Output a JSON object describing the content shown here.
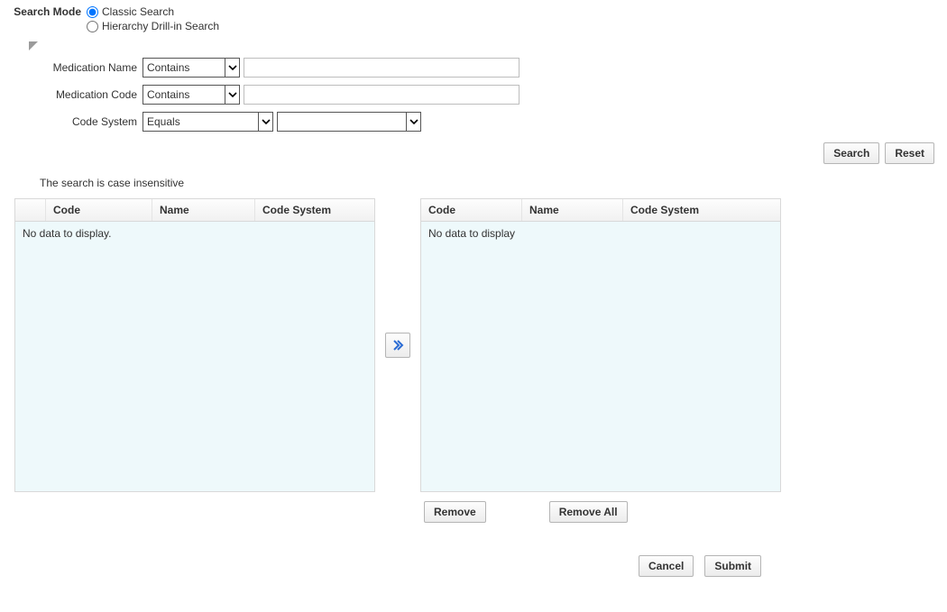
{
  "searchMode": {
    "label": "Search Mode",
    "options": {
      "classic": "Classic Search",
      "hierarchy": "Hierarchy Drill-in Search"
    },
    "selected": "classic"
  },
  "fields": {
    "medicationName": {
      "label": "Medication Name",
      "operator": "Contains",
      "value": ""
    },
    "medicationCode": {
      "label": "Medication Code",
      "operator": "Contains",
      "value": ""
    },
    "codeSystem": {
      "label": "Code System",
      "operator": "Equals",
      "value": ""
    }
  },
  "buttons": {
    "search": "Search",
    "reset": "Reset",
    "remove": "Remove",
    "removeAll": "Remove All",
    "cancel": "Cancel",
    "submit": "Submit"
  },
  "hint": "The search is case insensitive",
  "leftGrid": {
    "columns": {
      "select": "",
      "code": "Code",
      "name": "Name",
      "system": "Code System"
    },
    "empty": "No data to display."
  },
  "rightGrid": {
    "columns": {
      "code": "Code",
      "name": "Name",
      "system": "Code System"
    },
    "empty": "No data to display"
  }
}
